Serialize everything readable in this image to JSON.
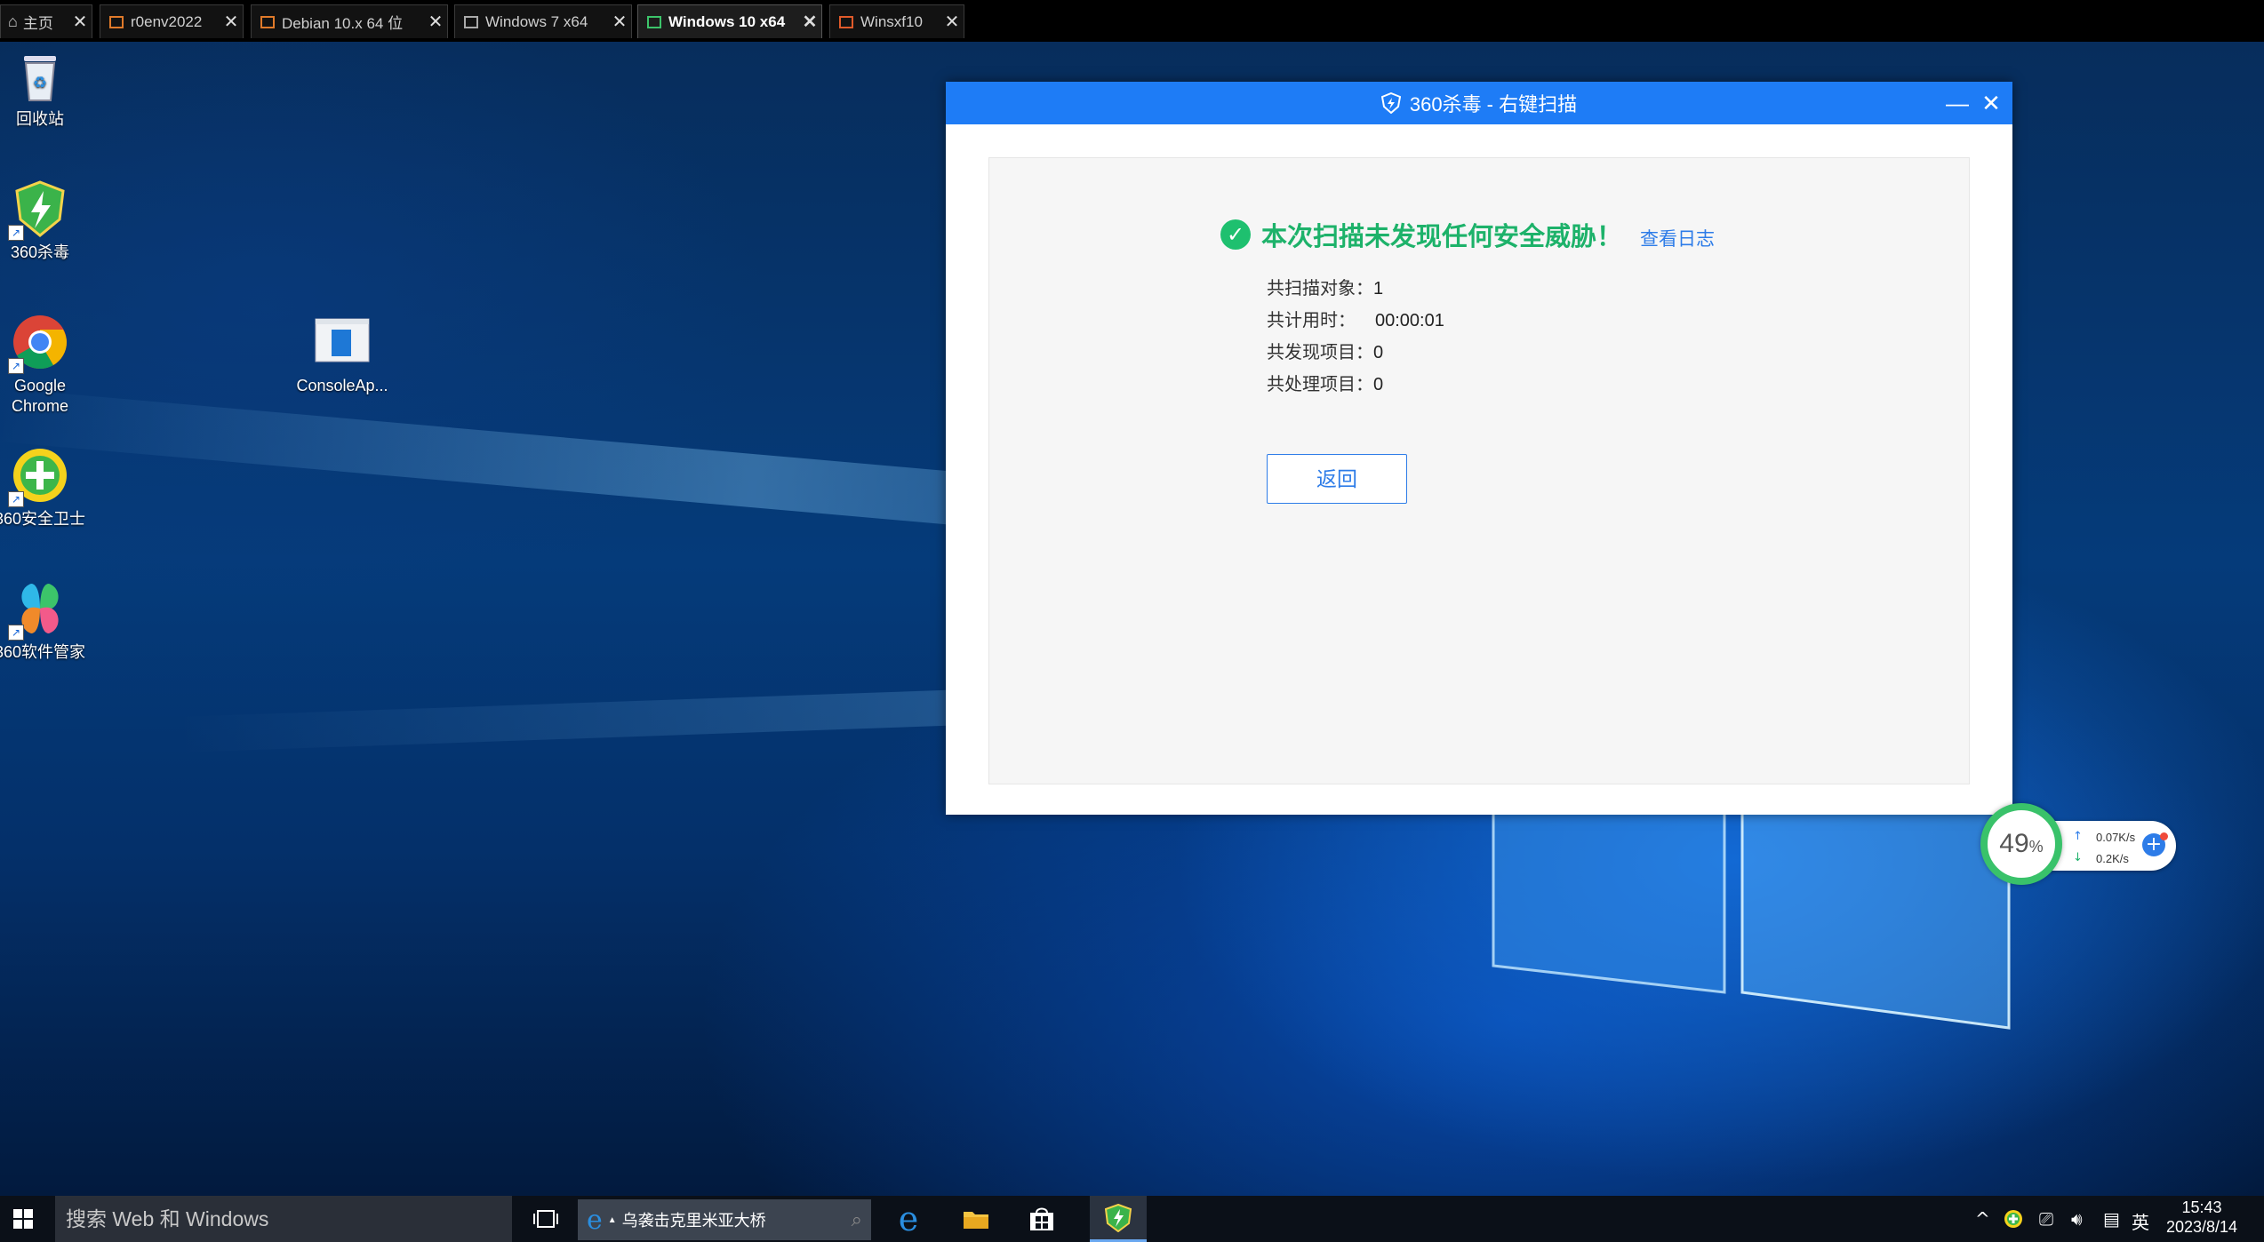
{
  "tabs": [
    {
      "label": "主页",
      "active": false
    },
    {
      "label": "r0env2022",
      "active": false
    },
    {
      "label": "Debian 10.x 64 位",
      "active": false
    },
    {
      "label": "Windows 7 x64",
      "active": false
    },
    {
      "label": "Windows 10 x64",
      "active": true
    },
    {
      "label": "Winsxf10",
      "active": false
    }
  ],
  "desktop_icons": [
    {
      "label": "回收站",
      "icon": "recycle-bin-icon"
    },
    {
      "label": "360杀毒",
      "icon": "360-antivirus-icon"
    },
    {
      "label": "Google Chrome",
      "icon": "chrome-icon"
    },
    {
      "label": "360安全卫士",
      "icon": "360-safe-icon"
    },
    {
      "label": "360软件管家",
      "icon": "360-software-manager-icon"
    },
    {
      "label": "ConsoleAp...",
      "icon": "console-app-icon"
    }
  ],
  "window": {
    "title": "360杀毒 - 右键扫描",
    "minimize": "—",
    "close": "✕",
    "accent_color": "#1e7cf6"
  },
  "scan": {
    "result_message": "本次扫描未发现任何安全威胁！",
    "view_log": "查看日志",
    "stats": [
      {
        "label": "共扫描对象：",
        "value": "1"
      },
      {
        "label": "共计用时：",
        "value": "00:00:01"
      },
      {
        "label": "共发现项目：",
        "value": "0"
      },
      {
        "label": "共处理项目：",
        "value": "0"
      }
    ],
    "back_button": "返回",
    "success_color": "#1db26a"
  },
  "widget": {
    "percent": "49",
    "percent_unit": "%",
    "upload": "0.07K/s",
    "download": "0.2K/s"
  },
  "taskbar": {
    "search_placeholder": "搜索 Web 和 Windows",
    "ie_title": "乌袭击克里米亚大桥",
    "time": "15:43",
    "date": "2023/8/14",
    "ime": "英"
  }
}
